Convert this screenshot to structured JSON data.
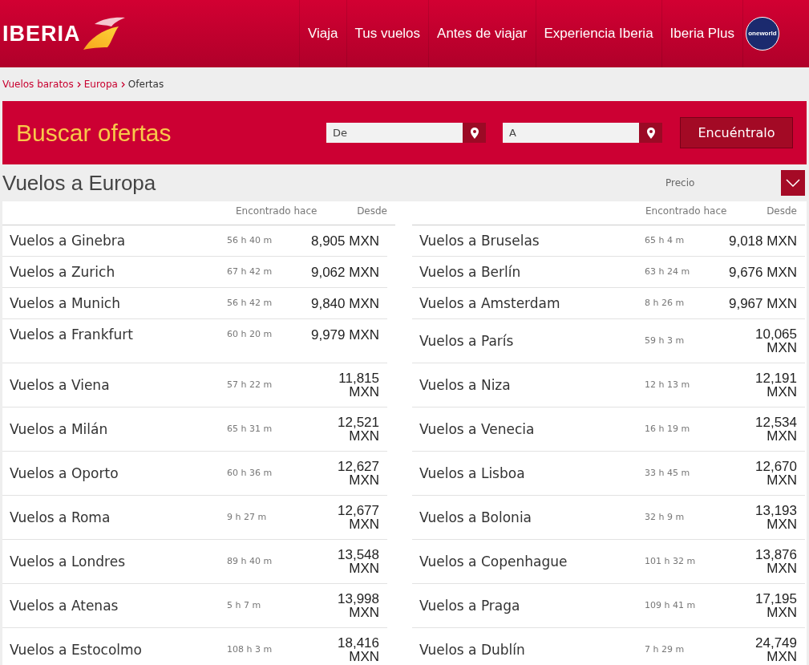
{
  "header": {
    "logo": "IBERIA",
    "nav": [
      "Viaja",
      "Tus vuelos",
      "Antes de viajar",
      "Experiencia Iberia",
      "Iberia Plus"
    ],
    "alliance_logo": "oneworld"
  },
  "breadcrumb": [
    {
      "label": "Vuelos baratos",
      "current": false
    },
    {
      "label": "Europa",
      "current": false
    },
    {
      "label": "Ofertas",
      "current": true
    }
  ],
  "search": {
    "title": "Buscar ofertas",
    "from": {
      "placeholder": "De"
    },
    "to": {
      "placeholder": "A"
    },
    "button": "Encuéntralo"
  },
  "results": {
    "title": "Vuelos a Europa",
    "sort": {
      "label": "Precio"
    },
    "columns": [
      {
        "found": "Encontrado hace",
        "price": "Desde"
      },
      {
        "found": "Encontrado hace",
        "price": "Desde"
      }
    ],
    "left": [
      {
        "destination": "Vuelos a Ginebra",
        "found": "56 h 40 m",
        "price": "8,905 MXN"
      },
      {
        "destination": "Vuelos a Zurich",
        "found": "67 h 42 m",
        "price": "9,062 MXN"
      },
      {
        "destination": "Vuelos a Munich",
        "found": "56 h 42 m",
        "price": "9,840 MXN"
      },
      {
        "destination": "Vuelos a Frankfurt",
        "found": "60 h 20 m",
        "price": "9,979 MXN"
      },
      {
        "destination": "Vuelos a Viena",
        "found": "57 h 22 m",
        "price": "11,815 MXN"
      },
      {
        "destination": "Vuelos a Milán",
        "found": "65 h 31 m",
        "price": "12,521 MXN"
      },
      {
        "destination": "Vuelos a Oporto",
        "found": "60 h 36 m",
        "price": "12,627 MXN"
      },
      {
        "destination": "Vuelos a Roma",
        "found": "9 h 27 m",
        "price": "12,677 MXN"
      },
      {
        "destination": "Vuelos a Londres",
        "found": "89 h 40 m",
        "price": "13,548 MXN"
      },
      {
        "destination": "Vuelos a Atenas",
        "found": "5 h 7 m",
        "price": "13,998 MXN"
      },
      {
        "destination": "Vuelos a Estocolmo",
        "found": "108 h 3 m",
        "price": "18,416 MXN"
      }
    ],
    "right": [
      {
        "destination": "Vuelos a Bruselas",
        "found": "65 h 4 m",
        "price": "9,018 MXN"
      },
      {
        "destination": "Vuelos a Berlín",
        "found": "63 h 24 m",
        "price": "9,676 MXN"
      },
      {
        "destination": "Vuelos a Amsterdam",
        "found": "8 h 26 m",
        "price": "9,967 MXN"
      },
      {
        "destination": "Vuelos a París",
        "found": "59 h 3 m",
        "price": "10,065 MXN"
      },
      {
        "destination": "Vuelos a Niza",
        "found": "12 h 13 m",
        "price": "12,191 MXN"
      },
      {
        "destination": "Vuelos a Venecia",
        "found": "16 h 19 m",
        "price": "12,534 MXN"
      },
      {
        "destination": "Vuelos a Lisboa",
        "found": "33 h 45 m",
        "price": "12,670 MXN"
      },
      {
        "destination": "Vuelos a Bolonia",
        "found": "32 h 9 m",
        "price": "13,193 MXN"
      },
      {
        "destination": "Vuelos a Copenhague",
        "found": "101 h 32 m",
        "price": "13,876 MXN"
      },
      {
        "destination": "Vuelos a Praga",
        "found": "109 h 41 m",
        "price": "17,195 MXN"
      },
      {
        "destination": "Vuelos a Dublín",
        "found": "7 h 29 m",
        "price": "24,749 MXN"
      }
    ]
  }
}
